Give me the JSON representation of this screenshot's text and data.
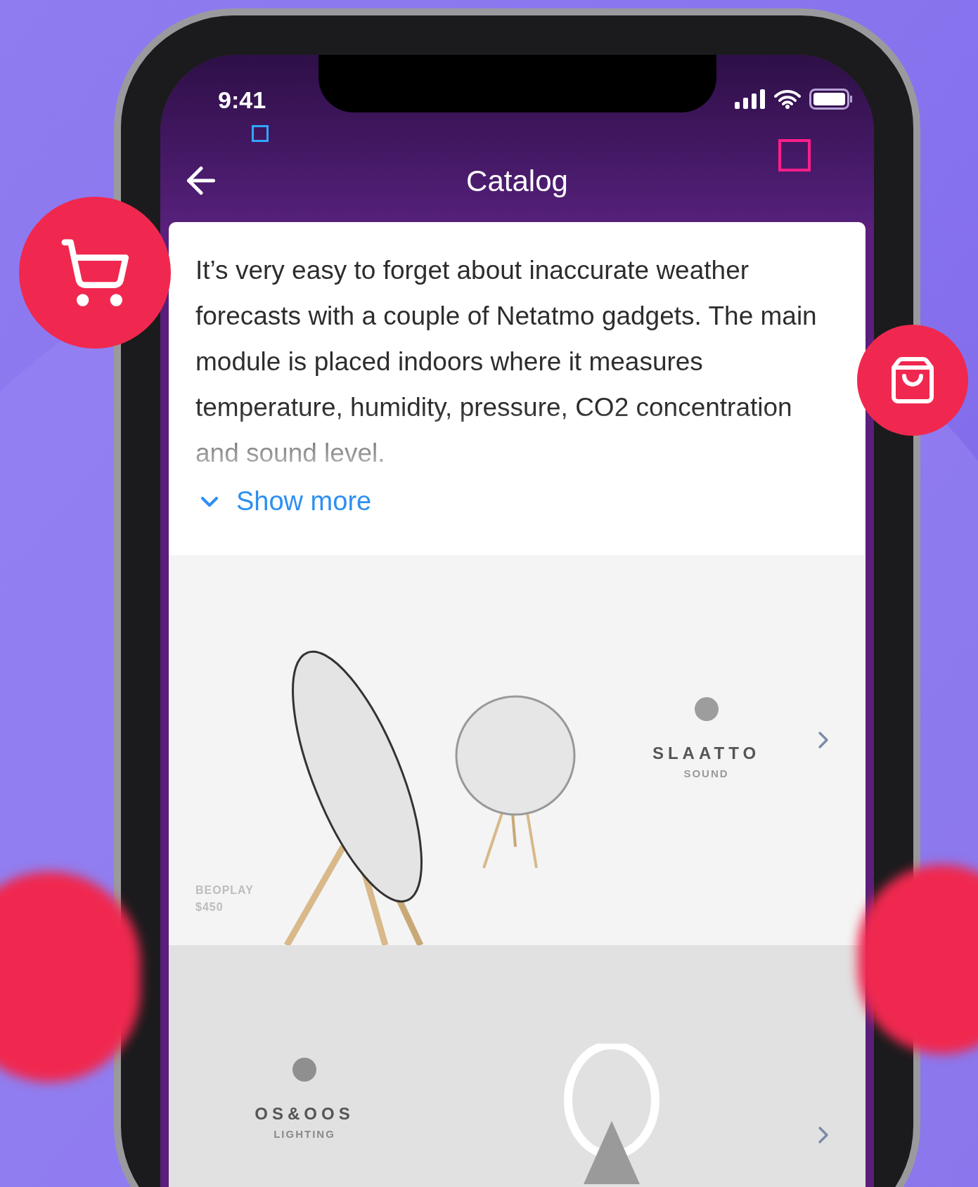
{
  "status_bar": {
    "time": "9:41"
  },
  "header": {
    "title": "Catalog"
  },
  "description": {
    "text": "It’s very easy to forget about inaccurate weather forecasts with a couple of Netatmo gadgets. The main module is placed indoors where it measures temperature, humidity, pressure, CO2 concentration and sound level.",
    "more_label": "Show more"
  },
  "products": [
    {
      "kind": "speaker",
      "brand": "SLAATTO",
      "brand_subtitle": "SOUND",
      "model": "BEOPLAY",
      "price": "$450"
    },
    {
      "kind": "lamp",
      "brand": "OS&OOS",
      "brand_subtitle": "LIGHTING"
    }
  ]
}
